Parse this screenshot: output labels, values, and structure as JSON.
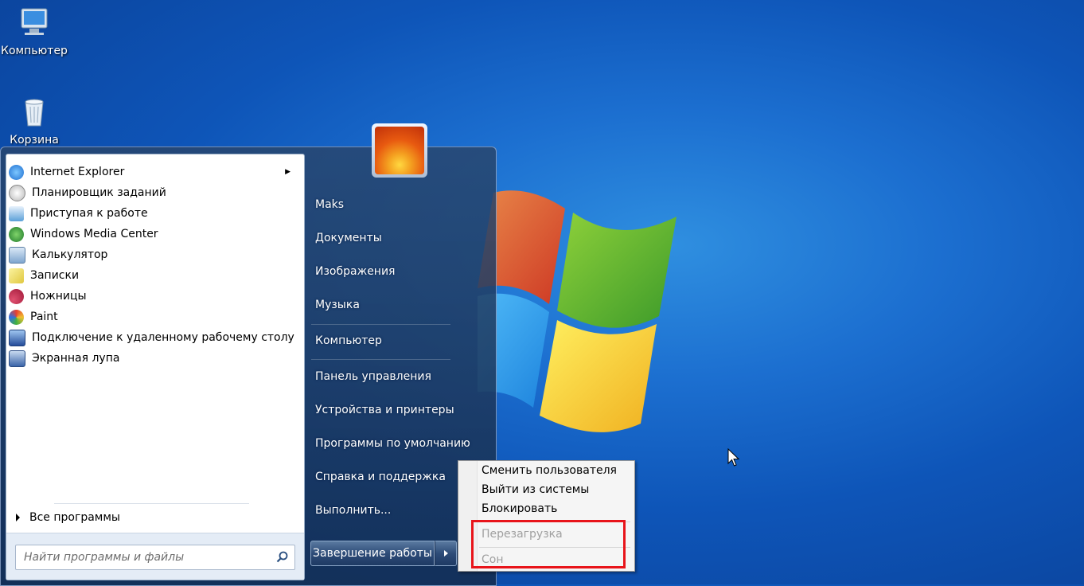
{
  "desktop": {
    "icons": [
      {
        "label": "Компьютер",
        "icon": "computer-icon"
      },
      {
        "label": "Корзина",
        "icon": "recycle-bin-icon"
      }
    ]
  },
  "start_menu": {
    "programs": [
      {
        "label": "Internet Explorer",
        "icon": "internet-explorer-icon",
        "color": "#2b8be0",
        "has_submenu": true
      },
      {
        "label": "Планировщик заданий",
        "icon": "task-scheduler-icon",
        "color": "#c9c9c9"
      },
      {
        "label": "Приступая к работе",
        "icon": "getting-started-icon",
        "color": "#5aa0d8"
      },
      {
        "label": "Windows Media Center",
        "icon": "media-center-icon",
        "color": "#2f9e3a"
      },
      {
        "label": "Калькулятор",
        "icon": "calculator-icon",
        "color": "#7fa6cf"
      },
      {
        "label": "Записки",
        "icon": "sticky-notes-icon",
        "color": "#e6d55a"
      },
      {
        "label": "Ножницы",
        "icon": "snipping-tool-icon",
        "color": "#d04060"
      },
      {
        "label": "Paint",
        "icon": "paint-icon",
        "color": "#e8a030"
      },
      {
        "label": "Подключение к удаленному рабочему столу",
        "icon": "remote-desktop-icon",
        "color": "#3a70c0"
      },
      {
        "label": "Экранная лупа",
        "icon": "magnifier-icon",
        "color": "#5080b0"
      }
    ],
    "all_programs": "Все программы",
    "search_placeholder": "Найти программы и файлы",
    "right_items": [
      "Maks",
      "Документы",
      "Изображения",
      "Музыка",
      "Компьютер",
      "Панель управления",
      "Устройства и принтеры",
      "Программы по умолчанию",
      "Справка и поддержка",
      "Выполнить..."
    ],
    "shutdown_label": "Завершение работы"
  },
  "shutdown_menu": {
    "items": [
      {
        "label": "Сменить пользователя",
        "enabled": true
      },
      {
        "label": "Выйти из системы",
        "enabled": true
      },
      {
        "label": "Блокировать",
        "enabled": true
      },
      {
        "label": "Перезагрузка",
        "enabled": false
      },
      {
        "label": "Сон",
        "enabled": false
      }
    ],
    "highlight_color": "#e8141a"
  }
}
